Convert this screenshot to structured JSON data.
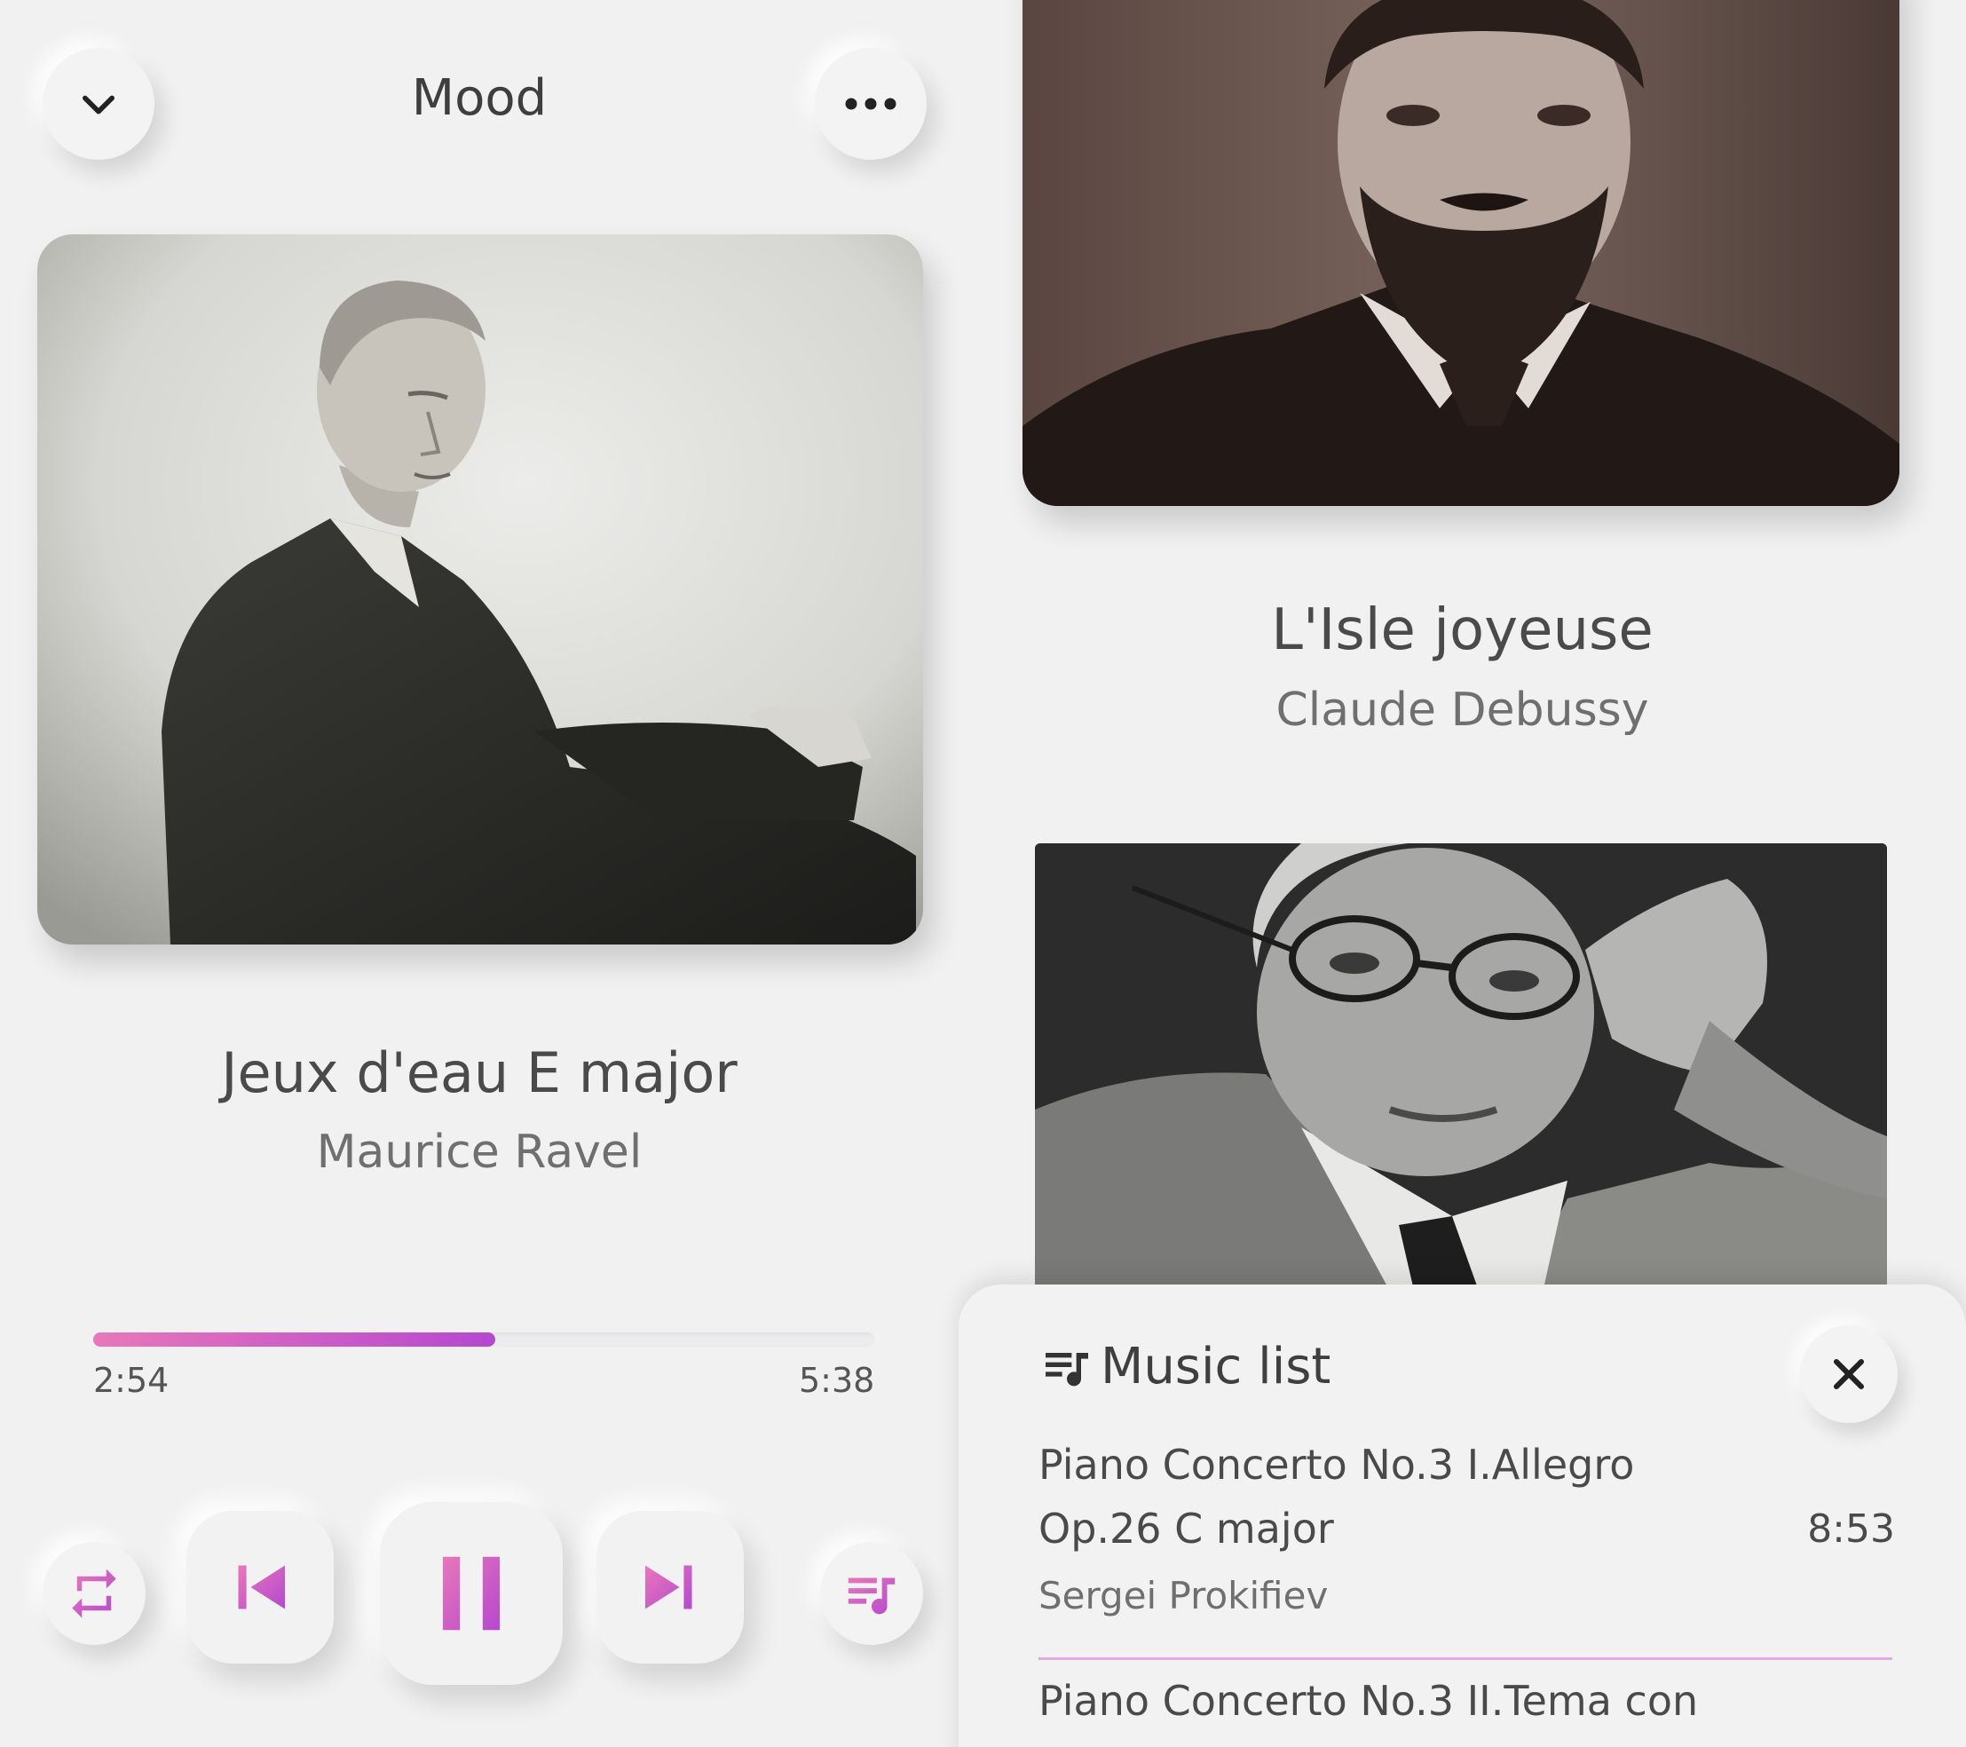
{
  "player": {
    "header_title": "Mood",
    "track_title": "Jeux d'eau E major",
    "track_artist": "Maurice Ravel",
    "elapsed": "2:54",
    "duration": "5:38",
    "progress_fraction": 0.515
  },
  "queue": {
    "next_title": "L'Isle joyeuse",
    "next_artist": "Claude Debussy"
  },
  "music_list": {
    "title": "Music list",
    "items": [
      {
        "title_line1": "Piano Concerto No.3 I.Allegro",
        "title_line2": "Op.26 C major",
        "duration": "8:53",
        "artist": "Sergei Prokifiev"
      },
      {
        "title_line1": "Piano Concerto No.3 II.Tema con"
      }
    ]
  },
  "icons": {
    "collapse": "chevron-down-icon",
    "more": "more-horizontal-icon",
    "repeat": "repeat-icon",
    "previous": "skip-previous-icon",
    "pause": "pause-icon",
    "next": "skip-next-icon",
    "playlist": "playlist-music-icon",
    "close": "close-icon"
  },
  "colors": {
    "accent_start": "#e977b9",
    "accent_end": "#b548d0",
    "background": "#f1f1f2"
  }
}
